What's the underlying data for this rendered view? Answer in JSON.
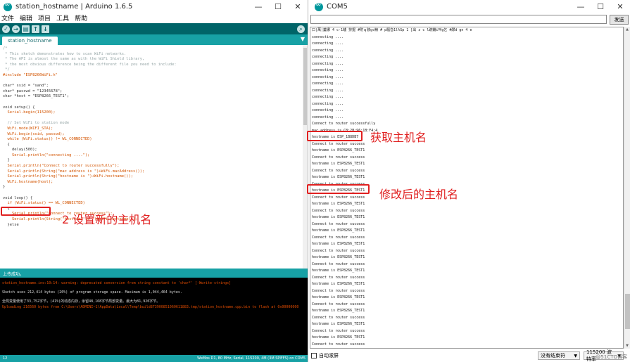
{
  "ide": {
    "title": "station_hostname | Arduino 1.6.5",
    "window_buttons": [
      "—",
      "☐",
      "✕"
    ],
    "menu": [
      "文件",
      "编辑",
      "项目",
      "工具",
      "帮助"
    ],
    "toolbar": [
      "✓",
      "→",
      "▤",
      "↑",
      "↓"
    ],
    "serial_monitor_icon": "⌕",
    "tab": "station_hostname",
    "tab_menu": "▼",
    "code": [
      "/*",
      " * This sketch demonstrates how to scan WiFi networks.",
      " * The API is almost the same as with the WiFi Shield library,",
      " * the most obvious difference being the different file you need to include:",
      " */",
      "#include \"ESP8266WiFi.h\"",
      "",
      "char* ssid = \"sand\";",
      "char* passwd = \"12345678\";",
      "char *host = \"ESP8266_TEST1\";",
      "",
      "void setup() {",
      "  Serial.begin(115200);",
      "",
      "  // Set WiFi to station mode",
      "  WiFi.mode(WIFI_STA);",
      "  WiFi.begin(ssid, passwd);",
      "  while (WiFi.status() != WL_CONNECTED)",
      "  {",
      "    delay(500);",
      "    Serial.println(\"connecting ....\");",
      "  }",
      "  Serial.println(\"Connect to router successfully\");",
      "  Serial.println(String(\"mac address is \")+WiFi.macAddress());",
      "  Serial.println(String(\"hostname is \")+WiFi.hostname());",
      "  WiFi.hostname(host);",
      "}",
      "",
      "void loop() {",
      "  if (WiFi.status() == WL_CONNECTED)",
      "  {",
      "    Serial.println(\"Connect to router success\");",
      "    Serial.println(String(\"hostname is \")+WiFi.hostname());",
      "  }else"
    ],
    "status": "上传成功。",
    "console": [
      {
        "text": "station_hostname.ino:10:14: warning: deprecated conversion from string constant to 'char*' [-Wwrite-strings]",
        "color": "orange"
      },
      {
        "text": "",
        "color": "gap"
      },
      {
        "text": "Sketch uses 212,414 bytes (20%) of program storage space. Maximum is 1,044,464 bytes.",
        "color": "white"
      },
      {
        "text": "",
        "color": "gap"
      },
      {
        "text": "全局变量使用了33,752字节，(41%)的动态内存，余留48,168字节局部变量。最大为81,920字节。",
        "color": "white"
      },
      {
        "text": "Uploading 216560 bytes from C:\\Users\\ADMINI~1\\AppData\\Local\\Temp\\build873900851060611883.tmp/station_hostname.cpp.bin to flash at 0x00000000",
        "color": "orange"
      }
    ],
    "line_number": "12",
    "board_info": "WeMos D1, 80 MHz, Serial, 115200, 4M (3M SPIFFS) on COM5"
  },
  "serial": {
    "title": "COM5",
    "window_buttons": [
      "—",
      "☐",
      "✕"
    ],
    "send_value": "",
    "send_label": "发送",
    "scroll_up": "▲",
    "scroll_down": "▼",
    "lines": [
      "口|萬|蒌娜     4  c-1蛐   拚掘   #附ｑ骸gc鯓   #  p騷旮1l%Sp   1  [出    z c  l跡鐖i叫g乞 #醪d     gn  4  e",
      "connecting ....",
      "connecting ....",
      "connecting ....",
      "connecting ....",
      "connecting ....",
      "connecting ....",
      "connecting ....",
      "connecting ....",
      "connecting ....",
      "connecting ....",
      "connecting ....",
      "connecting ....",
      "connecting ....",
      "Connect to router successfully",
      "mac address is C8:2B:96:1B:F4:4",
      "hostname is ESP_1B8DB7",
      "Connect to router success",
      "hostname is ESP8266_TEST1",
      "Connect to router success",
      "hostname is ESP8266_TEST1",
      "Connect to router success",
      "hostname is ESP8266_TEST1",
      "Connect to router success",
      "hostname is ESP8266_TEST1",
      "Connect to router success",
      "hostname is ESP8266_TEST1",
      "Connect to router success",
      "hostname is ESP8266_TEST1",
      "Connect to router success",
      "hostname is ESP8266_TEST1",
      "Connect to router success",
      "hostname is ESP8266_TEST1",
      "Connect to router success",
      "hostname is ESP8266_TEST1",
      "Connect to router success",
      "hostname is ESP8266_TEST1",
      "Connect to router success",
      "hostname is ESP8266_TEST1",
      "Connect to router success",
      "hostname is ESP8266_TEST1",
      "Connect to router success",
      "hostname is ESP8266_TEST1",
      "Connect to router success",
      "hostname is ESP8266_TEST1",
      "Connect to router success",
      "hostname is ESP8266_TEST1",
      "Connect to router success"
    ],
    "autoscroll_label": "自动滚屏",
    "line_ending": "没有结束符",
    "baud": "115200 波特率",
    "watermark": "@51CTO博客"
  },
  "annotations": {
    "get_hostname": "获取主机名",
    "modified_hostname": "修改后的主机名",
    "set_hostname": "2 设置新的主机名"
  },
  "colors": {
    "arduino_teal": "#17a1a5",
    "arduino_dark": "#006468",
    "annotation_red": "#e02020",
    "console_orange": "#e34c00"
  }
}
